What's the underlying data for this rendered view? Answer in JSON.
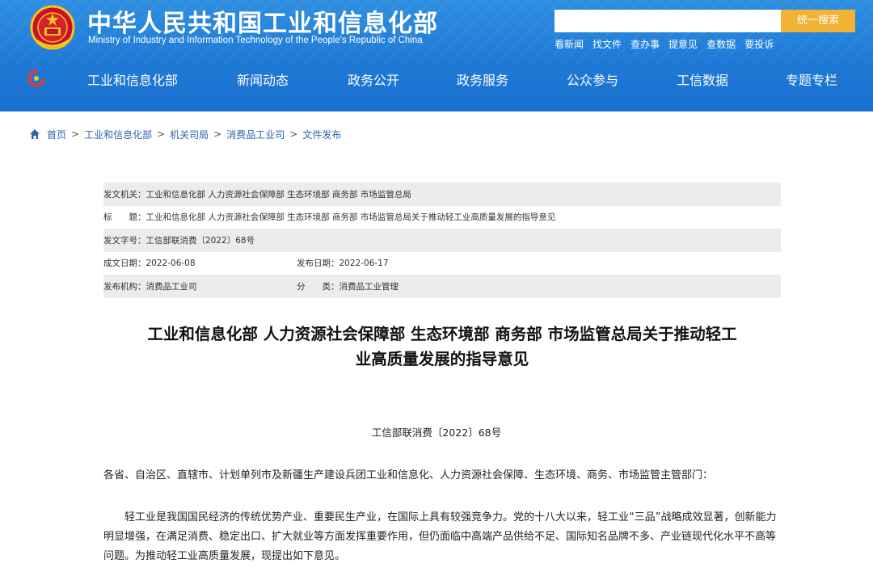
{
  "header": {
    "site_title": "中华人民共和国工业和信息化部",
    "site_subtitle": "Ministry of Industry and Information Technology of the People's Republic of China",
    "search": {
      "placeholder": "",
      "button_label": "统一搜索"
    },
    "quick_links": [
      "看新闻",
      "找文件",
      "查办事",
      "提意见",
      "查数据",
      "要投诉"
    ]
  },
  "nav": {
    "items": [
      "工业和信息化部",
      "新闻动态",
      "政务公开",
      "政务服务",
      "公众参与",
      "工信数据",
      "专题专栏"
    ]
  },
  "breadcrumb": {
    "items": [
      "首页",
      "工业和信息化部",
      "机关司局",
      "消费品工业司",
      "文件发布"
    ],
    "separator": ">"
  },
  "meta": {
    "issuer": {
      "label": "发文机关：",
      "value": "工业和信息化部 人力资源社会保障部 生态环境部 商务部 市场监管总局"
    },
    "title": {
      "label": "标　　题：",
      "value": "工业和信息化部 人力资源社会保障部 生态环境部 商务部 市场监管总局关于推动轻工业高质量发展的指导意见"
    },
    "doc_no": {
      "label": "发文字号：",
      "value": "工信部联消费〔2022〕68号"
    },
    "written_date": {
      "label": "成文日期：",
      "value": "2022-06-08"
    },
    "publish_date": {
      "label": "发布日期：",
      "value": "2022-06-17"
    },
    "agency": {
      "label": "发布机构：",
      "value": "消费品工业司"
    },
    "category": {
      "label": "分　　类：",
      "value": "消费品工业管理"
    }
  },
  "article": {
    "title_line1": "工业和信息化部 人力资源社会保障部 生态环境部 商务部 市场监管总局关于推动轻工",
    "title_line2": "业高质量发展的指导意见",
    "doc_number": "工信部联消费〔2022〕68号",
    "salutation": "各省、自治区、直辖市、计划单列市及新疆生产建设兵团工业和信息化、人力资源社会保障、生态环境、商务、市场监管主管部门：",
    "paragraph1": "轻工业是我国国民经济的传统优势产业、重要民生产业，在国际上具有较强竞争力。党的十八大以来，轻工业“三品”战略成效显著，创新能力明显增强，在满足消费、稳定出口、扩大就业等方面发挥重要作用，但仍面临中高端产品供给不足、国际知名品牌不多、产业链现代化水平不高等问题。为推动轻工业高质量发展，现提出如下意见。"
  },
  "colors": {
    "header_blue": "#1f7ad6",
    "search_button": "#f2b233",
    "link_blue": "#2a64b0",
    "meta_shade": "#ececec"
  },
  "icons": {
    "emblem": "national-emblem-icon",
    "nav_logo": "miit-logo-icon",
    "home": "home-icon"
  }
}
